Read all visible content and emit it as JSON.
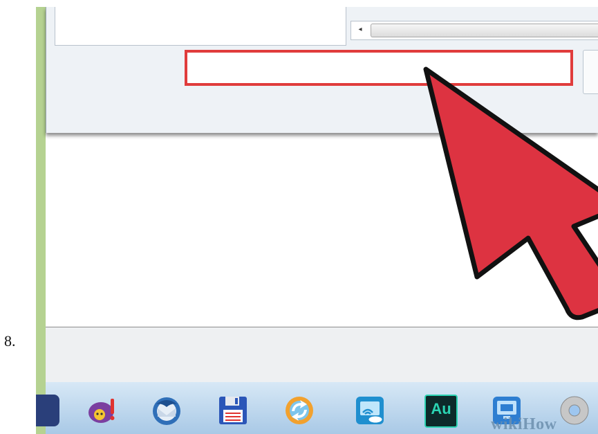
{
  "step": {
    "number": "8."
  },
  "dialog": {
    "scrollbar": {
      "left_arrow": "◂"
    }
  },
  "taskbar": {
    "apps": [
      "yahoo-messenger",
      "thunderbird",
      "save-disk",
      "refresh",
      "intel-wireless-display",
      "adobe-audition",
      "remote-desktop",
      "chrome"
    ]
  },
  "audition": {
    "label": "Au"
  },
  "watermark": {
    "text": "wikiHow"
  },
  "colors": {
    "frame_border": "#b5d291",
    "highlight": "#e03c3c",
    "cursor_fill": "#dd3341",
    "cursor_outline": "#111111",
    "taskbar_top": "#d7e8f6",
    "taskbar_bottom": "#a9c9e6"
  }
}
